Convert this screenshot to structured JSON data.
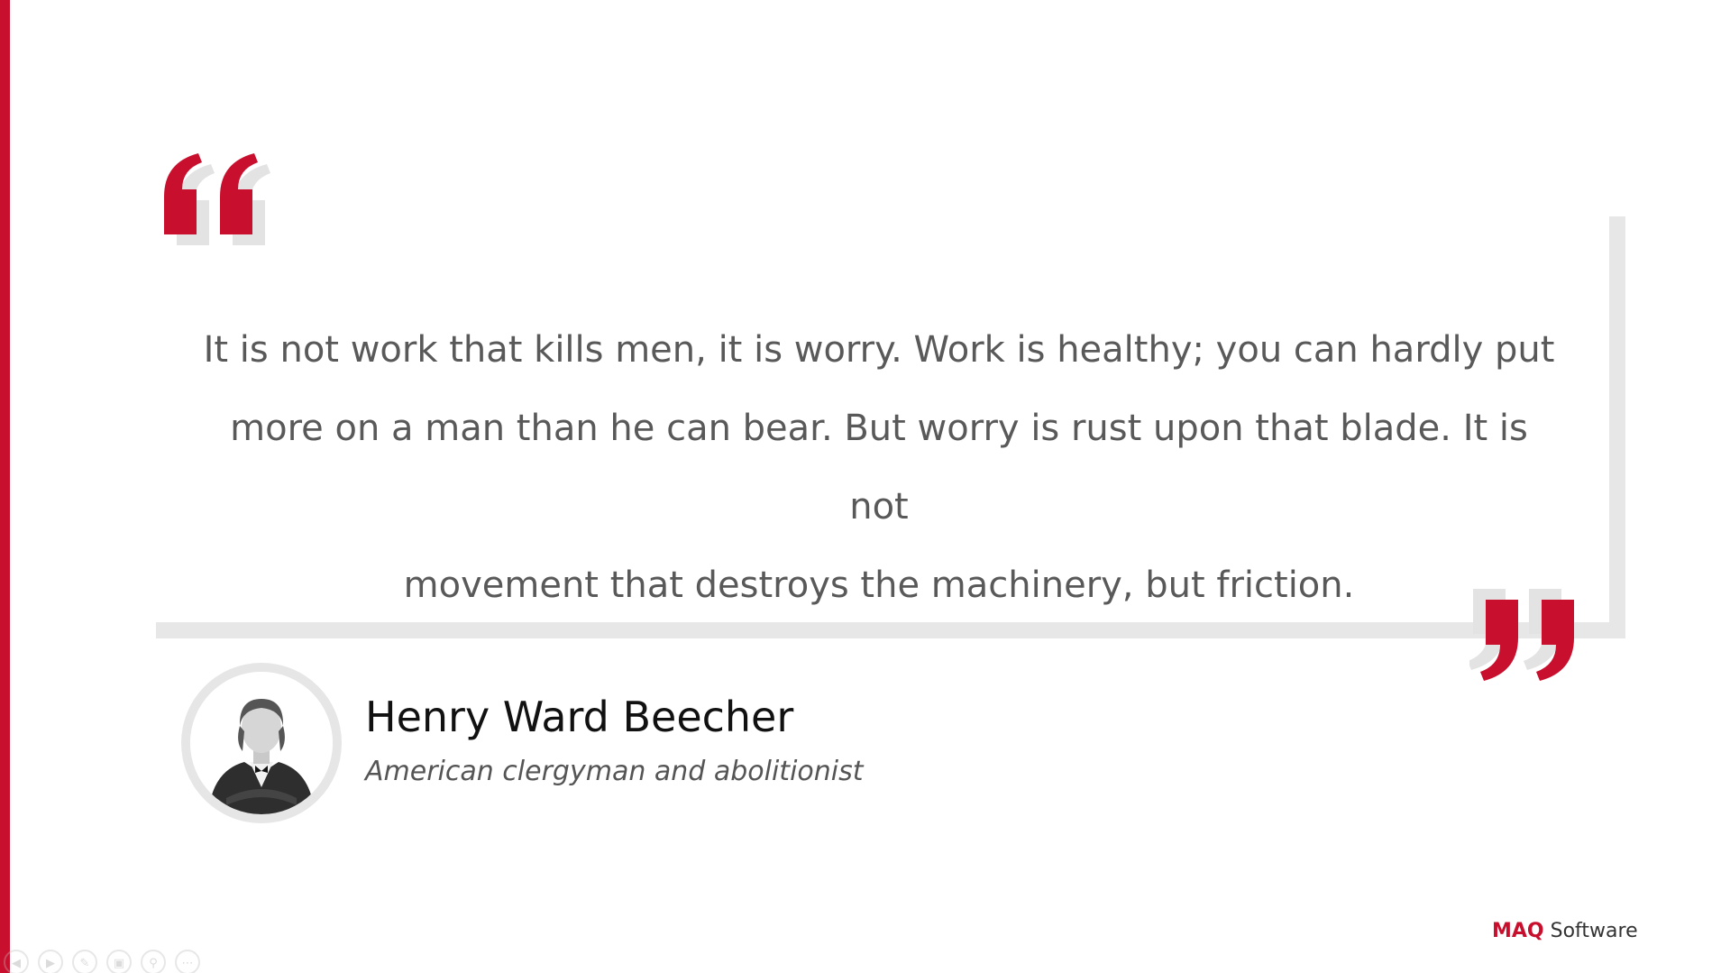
{
  "quote": {
    "lines": [
      "It is not work that kills men, it is worry. Work is healthy; you can hardly put",
      "more on a man than he can bear. But worry is rust upon that blade. It is not",
      "movement that destroys the machinery, but friction."
    ]
  },
  "author": {
    "name": "Henry Ward Beecher",
    "title": "American clergyman and abolitionist"
  },
  "logo": {
    "mark": "MAQ",
    "word": " Software"
  },
  "colors": {
    "accent": "#c8102e",
    "frame": "#e7e7e7",
    "quote_text": "#595959"
  },
  "controls": {
    "icons": [
      "previous-icon",
      "next-icon",
      "pen-icon",
      "slides-icon",
      "zoom-icon",
      "more-icon"
    ]
  }
}
